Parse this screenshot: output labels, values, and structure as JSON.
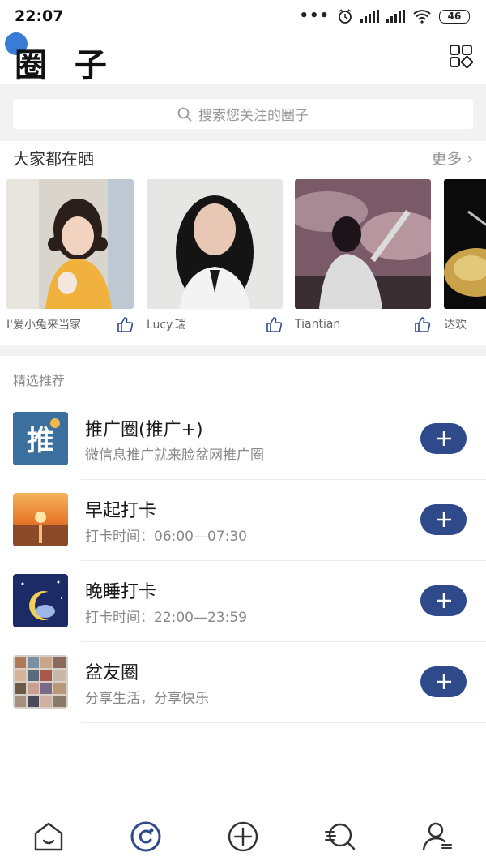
{
  "status": {
    "time": "22:07",
    "battery": "46"
  },
  "header": {
    "title": "圈 子"
  },
  "search": {
    "placeholder": "搜索您关注的圈子"
  },
  "everyone": {
    "title": "大家都在晒",
    "more": "更多",
    "posts": [
      {
        "user": "I'爱小兔来当家"
      },
      {
        "user": "Lucy.瑞"
      },
      {
        "user": "Tiantian"
      },
      {
        "user": "达欢"
      }
    ]
  },
  "recommended": {
    "title": "精选推荐",
    "items": [
      {
        "name": "推广圈(推广+)",
        "desc": "微信息推广就来脸盆网推广圈",
        "thumb_char": "推"
      },
      {
        "name": "早起打卡",
        "desc": "打卡时间：06:00—07:30"
      },
      {
        "name": "晚睡打卡",
        "desc": "打卡时间：22:00—23:59"
      },
      {
        "name": "盆友圈",
        "desc": "分享生活，分享快乐"
      }
    ]
  },
  "colors": {
    "accent": "#2f4a8a",
    "band": "#f2f2f2",
    "active_nav": "#2f4a8a"
  },
  "icons": [
    "search-icon",
    "grid-icon",
    "like-icon",
    "plus-icon",
    "home-icon",
    "circle-icon",
    "add-icon",
    "discover-icon",
    "profile-icon"
  ]
}
